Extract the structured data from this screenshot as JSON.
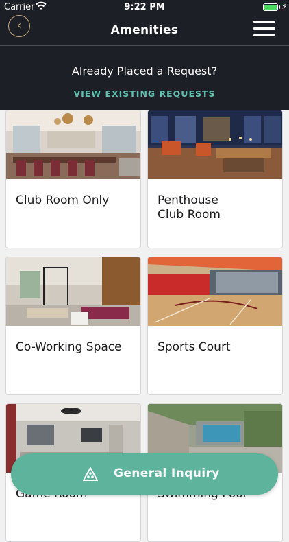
{
  "status": {
    "carrier": "Carrier",
    "time": "9:22 PM"
  },
  "header": {
    "title": "Amenities"
  },
  "banner": {
    "question": "Already Placed a Request?",
    "link": "VIEW EXISTING REQUESTS"
  },
  "amenities": [
    {
      "label": "Club Room Only"
    },
    {
      "label": "Penthouse\nClub Room"
    },
    {
      "label": "Co-Working Space"
    },
    {
      "label": "Sports Court"
    },
    {
      "label": "Game Room"
    },
    {
      "label": "Swimming Pool"
    }
  ],
  "fab": {
    "label": "General Inquiry"
  },
  "colors": {
    "dark": "#1d1f26",
    "accent": "#5fc0ad",
    "fab": "#5db39c",
    "back_ring": "#c9a87a"
  }
}
